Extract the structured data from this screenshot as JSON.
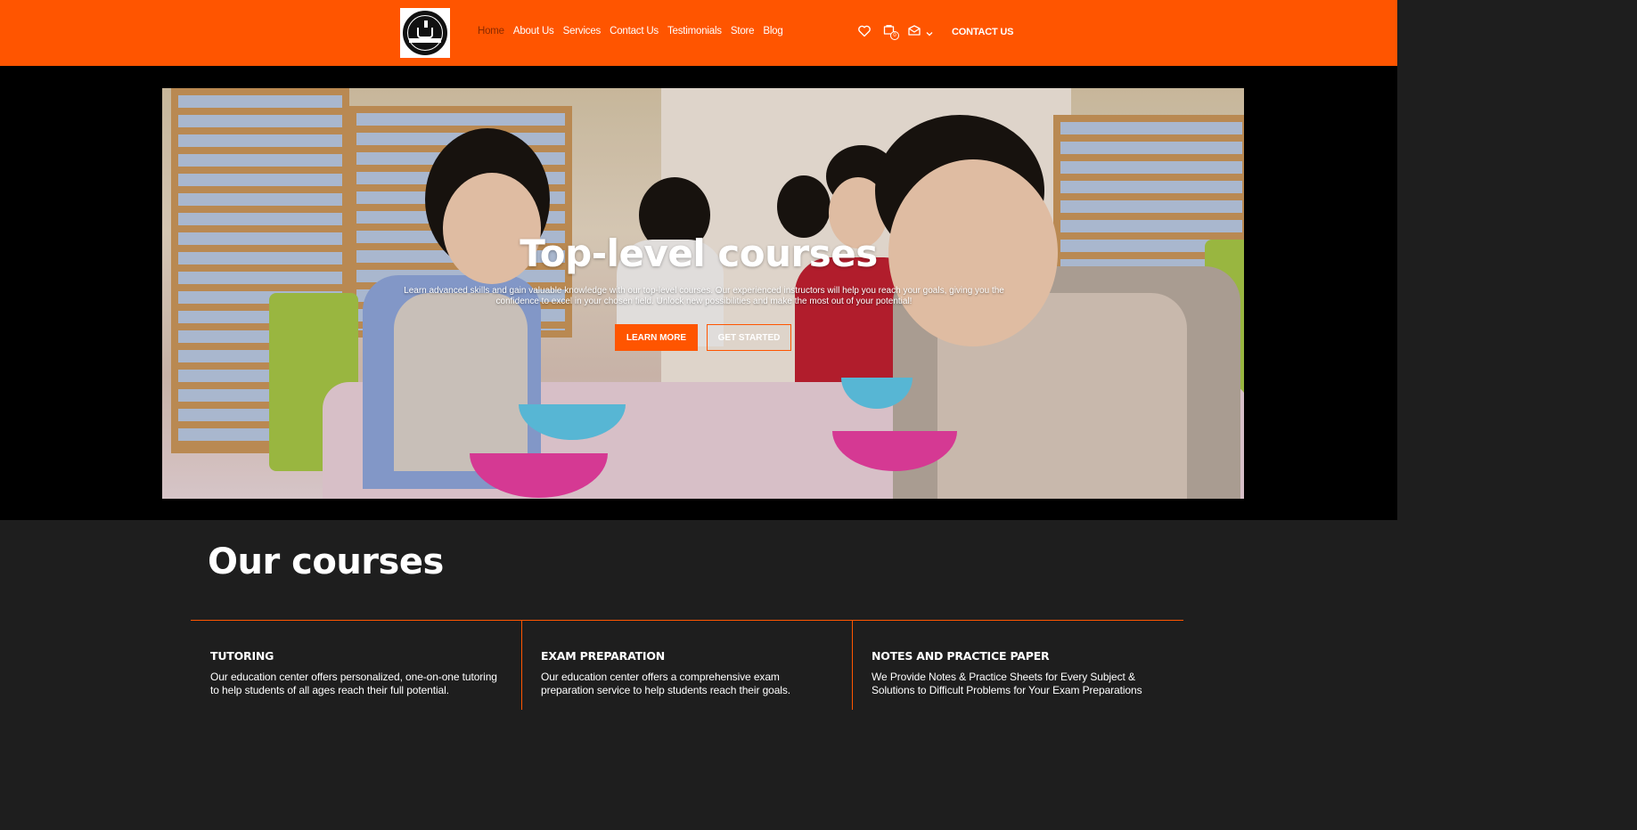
{
  "header": {
    "nav": [
      {
        "label": "Home",
        "active": true
      },
      {
        "label": "About Us"
      },
      {
        "label": "Services"
      },
      {
        "label": "Contact Us"
      },
      {
        "label": "Testimonials"
      },
      {
        "label": "Store"
      },
      {
        "label": "Blog"
      }
    ],
    "cart_count": "0",
    "cta_label": "CONTACT US",
    "icons": [
      "heart-icon",
      "cart-icon",
      "mail-icon",
      "chevron-down-icon"
    ],
    "brand_color": "#ff5500"
  },
  "hero": {
    "title": "Top-level courses",
    "subtitle": "Learn advanced skills and gain valuable knowledge with our top-level courses. Our experienced instructors will help you reach your goals, giving you the confidence to excel in your chosen field. Unlock new possibilities and make the most out of your potential!",
    "learn_more": "LEARN MORE",
    "get_started": "GET STARTED"
  },
  "courses": {
    "heading": "Our courses",
    "items": [
      {
        "title": "TUTORING",
        "text": "Our education center offers personalized, one-on-one tutoring to help students of all ages reach their full potential."
      },
      {
        "title": "EXAM PREPARATION",
        "text": "Our education center offers a comprehensive exam preparation service to help students reach their goals."
      },
      {
        "title": "NOTES AND PRACTICE PAPER",
        "text": "We Provide Notes & Practice Sheets for Every Subject & Solutions to Difficult Problems for Your Exam Preparations"
      }
    ]
  }
}
